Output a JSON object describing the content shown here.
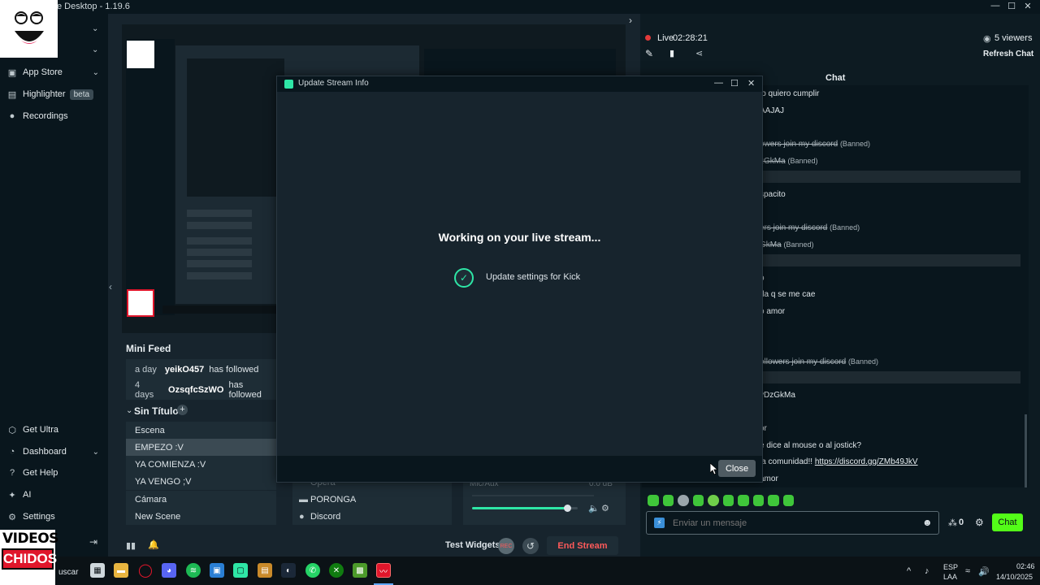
{
  "window": {
    "title": "e Desktop - 1.19.6"
  },
  "nav": {
    "app_store": "App Store",
    "highlighter": "Highlighter",
    "highlighter_badge": "beta",
    "recordings": "Recordings",
    "get_ultra": "Get Ultra",
    "dashboard": "Dashboard",
    "get_help": "Get Help",
    "ai": "AI",
    "settings": "Settings"
  },
  "watermark": {
    "line1": "VIDEOS",
    "line2": "CHIDOS"
  },
  "mini_feed": {
    "title": "Mini Feed",
    "rows": [
      {
        "when": "a day",
        "user": "yeikO457",
        "action": "has followed"
      },
      {
        "when": "4 days",
        "user": "OzsqfcSzWO",
        "action": "has followed"
      }
    ]
  },
  "scenes": {
    "collection_title": "Sin Título",
    "items": [
      "Escena",
      "EMPEZO :V",
      "YA COMIENZA :V",
      "YA VENGO ;V",
      "Cámara",
      "New Scene"
    ],
    "selected_index": 1
  },
  "sources": {
    "items": [
      "Opera",
      "PORONGA",
      "Discord"
    ]
  },
  "mixer": {
    "label": "Mic/Aux",
    "level": "0.0 dB",
    "volume_fraction": 0.9
  },
  "bottom": {
    "test_widgets": "Test Widgets",
    "rec": "REC",
    "end_stream": "End Stream"
  },
  "live": {
    "status": "Live",
    "time": "02:28:21",
    "viewers": "5 viewers",
    "refresh_chat": "Refresh Chat",
    "chat_title": "Chat"
  },
  "chat": {
    "lines": [
      {
        "text": "lo quiero cumplir",
        "banned": false
      },
      {
        "text": "AAJAJ",
        "banned": false
      },
      {
        "text": "owers join my discord",
        "banned": true,
        "tag": "(Banned)"
      },
      {
        "text": "zGkMa",
        "banned": true,
        "tag": "(Banned)"
      },
      {
        "text": "spacito",
        "banned": false
      },
      {
        "text": "ers join my discord",
        "banned": true,
        "tag": "(Banned)"
      },
      {
        "text": "GkMa",
        "banned": true,
        "tag": "(Banned)"
      },
      {
        "text": "o",
        "banned": false
      },
      {
        "text": "da q se me cae",
        "banned": false
      },
      {
        "text": "o amor",
        "banned": false
      },
      {
        "text": "ollowers join my discord",
        "banned": true,
        "tag": "(Banned)"
      },
      {
        "text": "vDzGkMa",
        "banned": false
      },
      {
        "text": "or",
        "banned": false
      },
      {
        "text": "e dice al mouse o al jostick?",
        "banned": false
      },
      {
        "text": "la comunidad!!",
        "banned": false,
        "link": "https://discord.gg/ZMb49JkV"
      },
      {
        "text": "amor",
        "banned": false
      }
    ],
    "input_placeholder": "Enviar un mensaje",
    "points": "0",
    "send_label": "Chat"
  },
  "modal": {
    "title": "Update Stream Info",
    "heading": "Working on your live stream...",
    "task": "Update settings for Kick",
    "close": "Close"
  },
  "taskbar": {
    "search_fragment": "uscar",
    "lang_line1": "ESP",
    "lang_line2": "LAA",
    "time": "02:46",
    "date": "14/10/2025"
  },
  "colors": {
    "accent": "#53fc18",
    "live_red": "#e23a3a",
    "end_stream": "#ff5a5a"
  }
}
